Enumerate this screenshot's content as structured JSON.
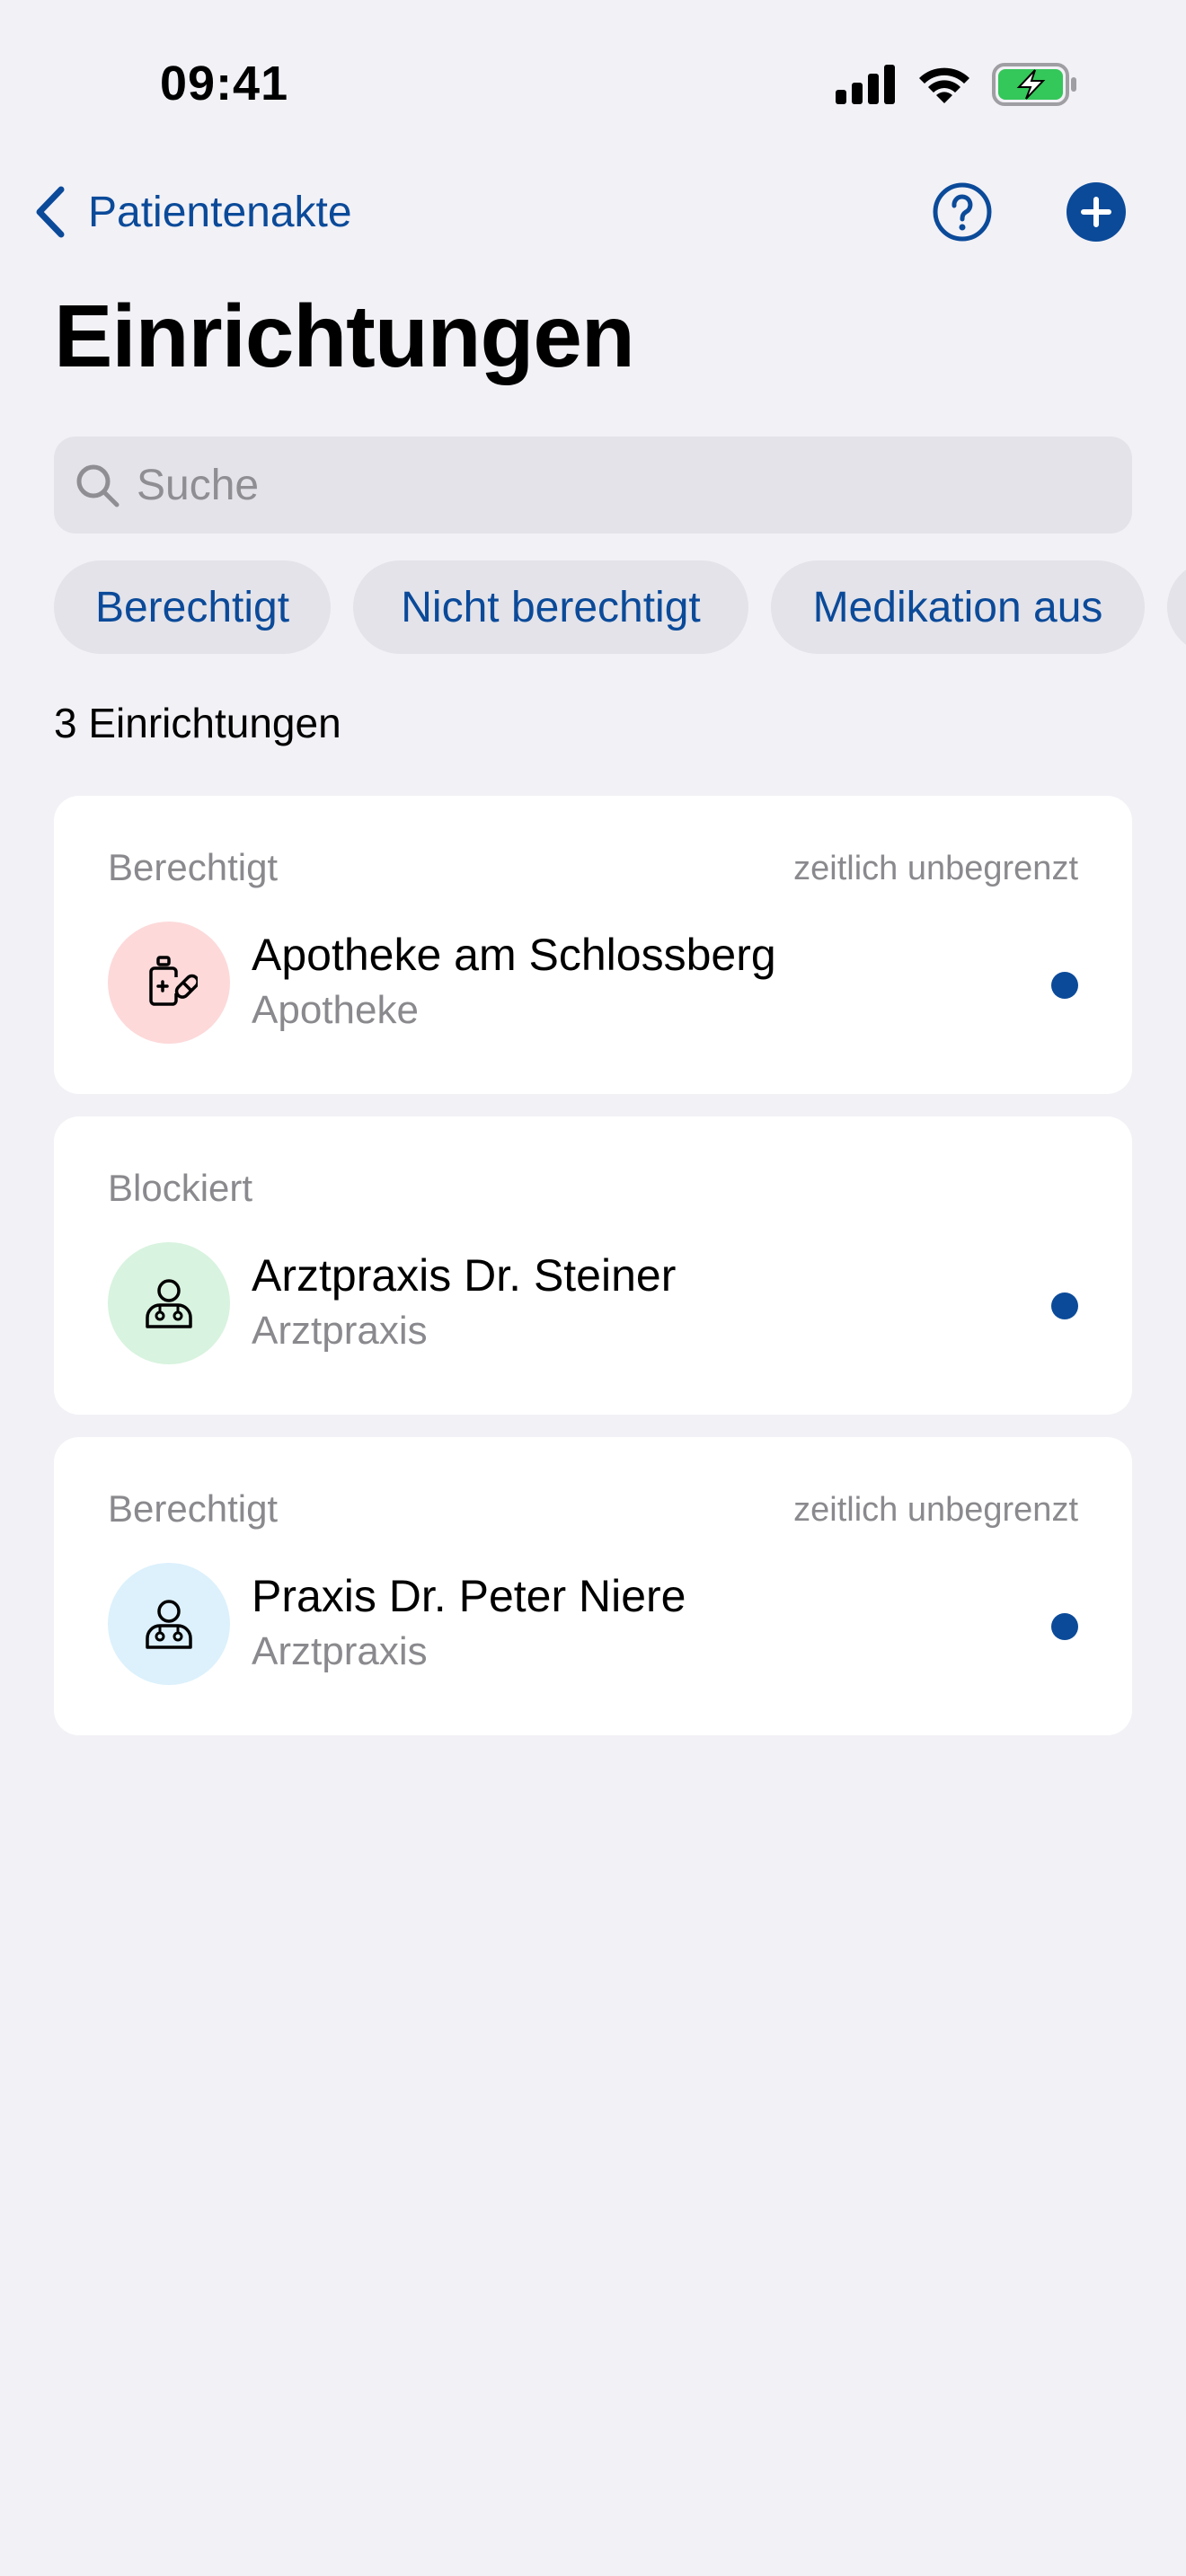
{
  "status_bar": {
    "time": "09:41",
    "icons": [
      "cellular-signal-icon",
      "wifi-icon",
      "battery-charging-icon"
    ]
  },
  "nav": {
    "back_label": "Patientenakte",
    "help_icon": "help-circle-icon",
    "add_icon": "plus-circle-icon"
  },
  "page": {
    "title": "Einrichtungen"
  },
  "search": {
    "placeholder": "Suche",
    "value": ""
  },
  "filters": [
    {
      "label": "Berechtigt"
    },
    {
      "label": "Nicht berechtigt"
    },
    {
      "label": "Medikation aus"
    }
  ],
  "result_count": "3 Einrichtungen",
  "facilities": [
    {
      "status": "Berechtigt",
      "duration": "zeitlich unbegrenzt",
      "name": "Apotheke am Schlossberg",
      "type": "Apotheke",
      "icon": "pharmacy-icon",
      "avatar_color": "#FDD9DA"
    },
    {
      "status": "Blockiert",
      "duration": "",
      "name": "Arztpraxis Dr. Steiner",
      "type": "Arztpraxis",
      "icon": "doctor-icon",
      "avatar_color": "#D8F3DF"
    },
    {
      "status": "Berechtigt",
      "duration": "zeitlich unbegrenzt",
      "name": "Praxis Dr. Peter Niere",
      "type": "Arztpraxis",
      "icon": "doctor-icon",
      "avatar_color": "#DCF1FC"
    }
  ],
  "colors": {
    "accent": "#0B4A99",
    "background": "#F2F1F6",
    "battery": "#34C759"
  }
}
